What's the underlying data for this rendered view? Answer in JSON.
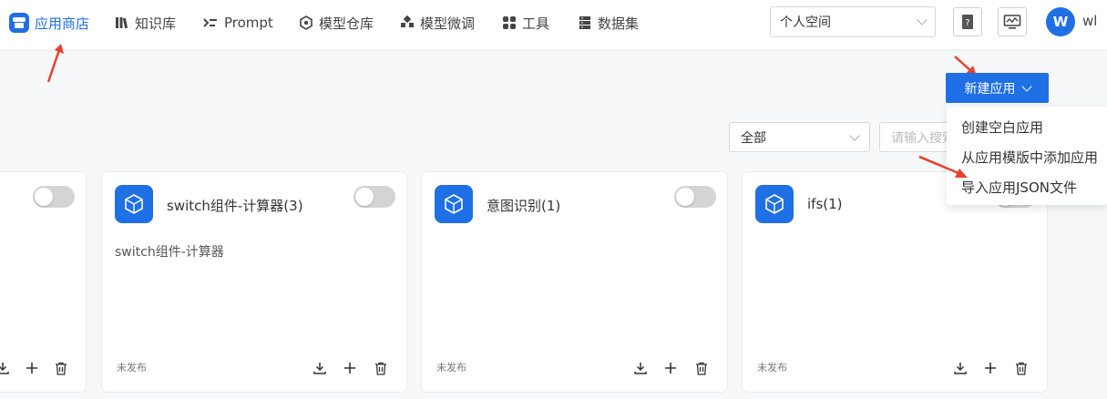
{
  "nav": {
    "items": [
      {
        "label": "应用商店",
        "icon": "store-icon",
        "active": true
      },
      {
        "label": "知识库",
        "icon": "books-icon"
      },
      {
        "label": "Prompt",
        "icon": "prompt-icon"
      },
      {
        "label": "模型仓库",
        "icon": "cube-icon"
      },
      {
        "label": "模型微调",
        "icon": "tuning-icon"
      },
      {
        "label": "工具",
        "icon": "grid-icon"
      },
      {
        "label": "数据集",
        "icon": "database-icon"
      }
    ]
  },
  "header": {
    "space_value": "个人空间",
    "help_icon": "help-book-icon",
    "monitor_icon": "monitor-icon",
    "avatar_letter": "W",
    "username": "wl"
  },
  "toolbar": {
    "new_app_label": "新建应用",
    "filter_value": "全部",
    "search_placeholder": "请输入搜索"
  },
  "new_app_menu": {
    "items": [
      "创建空白应用",
      "从应用模版中添加应用",
      "导入应用JSON文件"
    ]
  },
  "cards": [
    {
      "title": "",
      "description": "",
      "status": "",
      "enabled": false
    },
    {
      "title": "switch组件-计算器(3)",
      "description": "switch组件-计算器",
      "status": "未发布",
      "enabled": false
    },
    {
      "title": "意图识别(1)",
      "description": "",
      "status": "未发布",
      "enabled": false
    },
    {
      "title": "ifs(1)",
      "description": "",
      "status": "未发布",
      "enabled": false
    }
  ],
  "colors": {
    "accent": "#1f6fe5",
    "annotation": "#e8402a"
  }
}
